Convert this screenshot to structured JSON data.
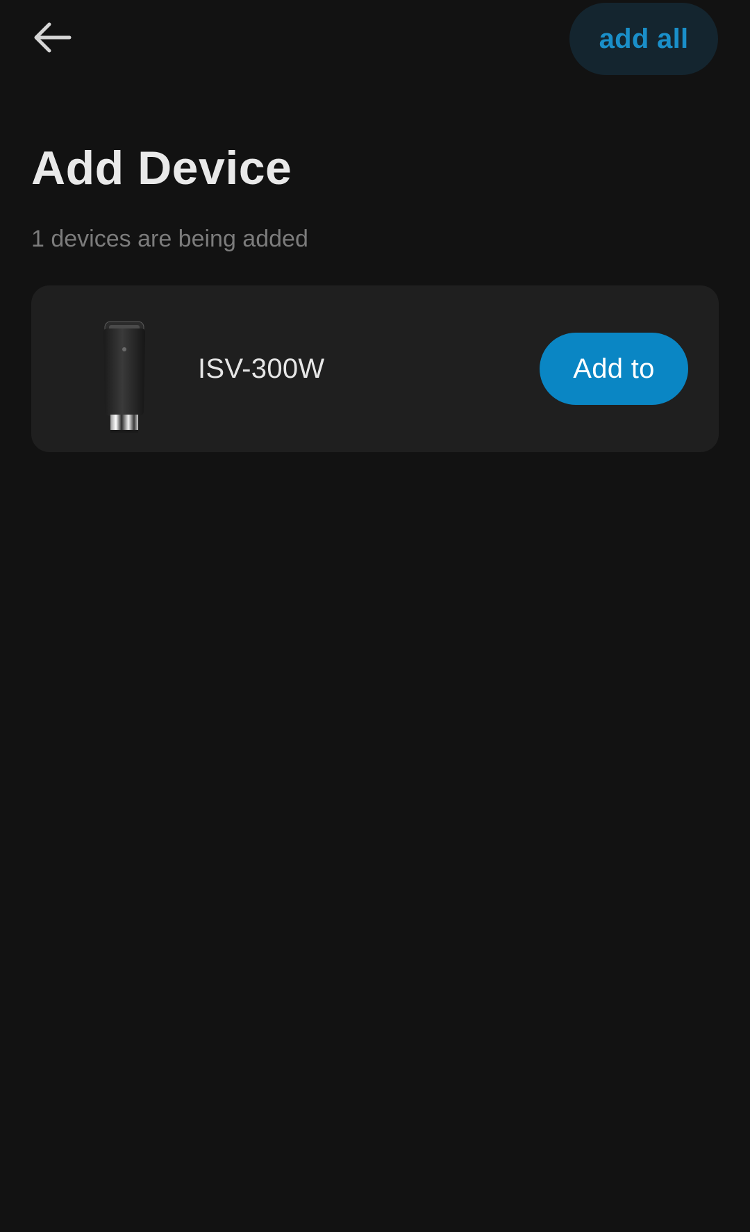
{
  "header": {
    "back_icon": "arrow-left-icon",
    "add_all_label": "add all"
  },
  "page": {
    "title": "Add Device",
    "subtitle": "1 devices are being added"
  },
  "devices": [
    {
      "name": "ISV-300W",
      "image_icon": "sous-vide-device-image",
      "action_label": "Add to"
    }
  ],
  "colors": {
    "background": "#121212",
    "card": "#1f1f1f",
    "accent": "#0a86c4",
    "add_all_bg": "#14252f",
    "add_all_text": "#1a8fc9",
    "subtitle": "#7c7c7c"
  }
}
